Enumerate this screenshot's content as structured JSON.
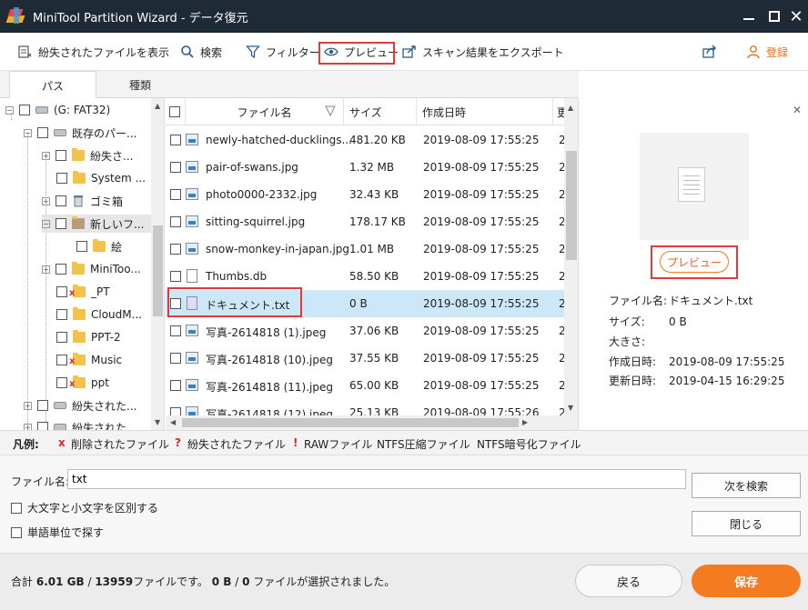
{
  "window": {
    "title": "MiniTool Partition Wizard - データ復元"
  },
  "toolbar": {
    "show_lost_files": "紛失されたファイルを表示",
    "search": "検索",
    "filter": "フィルター",
    "preview": "プレビュー",
    "export_scan": "スキャン結果をエクスポート",
    "register": "登録"
  },
  "tabs": {
    "path": "パス",
    "type": "種類"
  },
  "tree": {
    "items": [
      {
        "label": "(G: FAT32)"
      },
      {
        "label": "既存のパー..."
      },
      {
        "label": "紛失さ..."
      },
      {
        "label": "System ..."
      },
      {
        "label": "ゴミ箱"
      },
      {
        "label": "新しいフ..."
      },
      {
        "label": "絵"
      },
      {
        "label": "MiniToo..."
      },
      {
        "label": "_PT"
      },
      {
        "label": "CloudM..."
      },
      {
        "label": "PPT-2"
      },
      {
        "label": "Music"
      },
      {
        "label": "ppt"
      },
      {
        "label": "紛失された..."
      },
      {
        "label": "紛失された..."
      }
    ]
  },
  "filelist": {
    "headers": {
      "name": "ファイル名",
      "size": "サイズ",
      "created": "作成日時",
      "extra": "更"
    },
    "rows": [
      {
        "name": "newly-hatched-ducklings...",
        "size": "481.20 KB",
        "created": "2019-08-09 17:55:25",
        "extra": "2"
      },
      {
        "name": "pair-of-swans.jpg",
        "size": "1.32 MB",
        "created": "2019-08-09 17:55:25",
        "extra": "2"
      },
      {
        "name": "photo0000-2332.jpg",
        "size": "32.43 KB",
        "created": "2019-08-09 17:55:25",
        "extra": "2"
      },
      {
        "name": "sitting-squirrel.jpg",
        "size": "178.17 KB",
        "created": "2019-08-09 17:55:25",
        "extra": "2"
      },
      {
        "name": "snow-monkey-in-japan.jpg",
        "size": "1.01 MB",
        "created": "2019-08-09 17:55:25",
        "extra": "2"
      },
      {
        "name": "Thumbs.db",
        "size": "58.50 KB",
        "created": "2019-08-09 17:55:25",
        "extra": "2"
      },
      {
        "name": "ドキュメント.txt",
        "size": "0 B",
        "created": "2019-08-09 17:55:25",
        "extra": "2"
      },
      {
        "name": "写真-2614818 (1).jpeg",
        "size": "37.06 KB",
        "created": "2019-08-09 17:55:25",
        "extra": "2"
      },
      {
        "name": "写真-2614818 (10).jpeg",
        "size": "37.55 KB",
        "created": "2019-08-09 17:55:25",
        "extra": "2"
      },
      {
        "name": "写真-2614818 (11).jpeg",
        "size": "65.00 KB",
        "created": "2019-08-09 17:55:25",
        "extra": "2"
      },
      {
        "name": "写真-2614818 (12).jpeg",
        "size": "25.13 KB",
        "created": "2019-08-09 17:55:26",
        "extra": "2"
      }
    ]
  },
  "preview": {
    "button": "プレビュー",
    "info": [
      {
        "key": "ファイル名:",
        "value": "ドキュメント.txt"
      },
      {
        "key": "サイズ:",
        "value": "0 B"
      },
      {
        "key": "大きさ:",
        "value": ""
      },
      {
        "key": "作成日時:",
        "value": "2019-08-09 17:55:25"
      },
      {
        "key": "更新日時:",
        "value": "2019-04-15 16:29:25"
      }
    ]
  },
  "legend": {
    "title": "凡例:",
    "deleted_mark": "x",
    "deleted": "削除されたファイル",
    "lost_mark": "?",
    "lost": "紛失されたファイル",
    "raw_mark": "!",
    "raw": "RAWファイル",
    "ntfs_compressed": "NTFS圧縮ファイル",
    "ntfs_encrypted": "NTFS暗号化ファイル"
  },
  "search": {
    "label": "ファイル名:",
    "value": "txt",
    "find_next": "次を検索",
    "close": "閉じる",
    "match_case": "大文字と小文字を区別する",
    "whole_word": "単語単位で探す"
  },
  "footer": {
    "total_prefix": "合計",
    "total_size": "6.01 GB",
    "separator": "/",
    "total_files": "13959",
    "files_suffix": "ファイルです。",
    "selected_size": "0 B",
    "selected_files": "0",
    "selected_suffix": "ファイルが選択されました。",
    "back": "戻る",
    "save": "保存"
  }
}
